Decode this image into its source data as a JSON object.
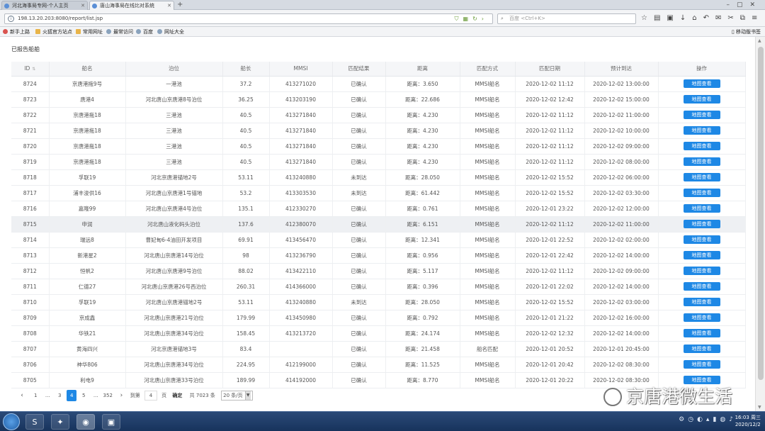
{
  "browser": {
    "tabs": [
      {
        "label": "河北海事局专网-个人主页"
      },
      {
        "label": "唐山海事局在线比对系统"
      }
    ],
    "new_tab": "+",
    "url": "198.13.20.203:8080/report/list.jsp",
    "search_placeholder": "百度 <Ctrl+K>",
    "bookmarks": [
      "新手上路",
      "火狐官方站点",
      "常用网址",
      "最常访问",
      "百度",
      "网址大全"
    ],
    "mobile_bookmarks": "移动版书签"
  },
  "page": {
    "title": "已报告船舶",
    "columns": [
      "ID",
      "船名",
      "泊位",
      "船长",
      "MMSI",
      "匹配结果",
      "距离",
      "匹配方式",
      "匹配日期",
      "预计到达",
      "操作"
    ],
    "action_label": "地图查看",
    "rows": [
      [
        "8724",
        "京唐港拖9号",
        "一港池",
        "37.2",
        "413271020",
        "已确认",
        "距离：3.650",
        "MMSI船名",
        "2020-12-02 11:12",
        "2020-12-02 13:00:00"
      ],
      [
        "8723",
        "唐港4",
        "河北唐山京唐港8号泊位",
        "36.25",
        "413203190",
        "已确认",
        "距离：22.686",
        "MMSI船名",
        "2020-12-02 12:42",
        "2020-12-02 15:00:00"
      ],
      [
        "8722",
        "京唐港拖18",
        "三港池",
        "40.5",
        "413271840",
        "已确认",
        "距离：4.230",
        "MMSI船名",
        "2020-12-02 11:12",
        "2020-12-02 11:00:00"
      ],
      [
        "8721",
        "京唐港拖18",
        "三港池",
        "40.5",
        "413271840",
        "已确认",
        "距离：4.230",
        "MMSI船名",
        "2020-12-02 11:12",
        "2020-12-02 10:00:00"
      ],
      [
        "8720",
        "京唐港拖18",
        "三港池",
        "40.5",
        "413271840",
        "已确认",
        "距离：4.230",
        "MMSI船名",
        "2020-12-02 11:12",
        "2020-12-02 09:00:00"
      ],
      [
        "8719",
        "京唐港拖18",
        "三港池",
        "40.5",
        "413271840",
        "已确认",
        "距离：4.230",
        "MMSI船名",
        "2020-12-02 11:12",
        "2020-12-02 08:00:00"
      ],
      [
        "8718",
        "孚联19",
        "河北京唐港锚地2号",
        "53.11",
        "413240880",
        "未到达",
        "距离：28.050",
        "MMSI船名",
        "2020-12-02 15:52",
        "2020-12-02 06:00:00"
      ],
      [
        "8717",
        "浦丰浚供16",
        "河北唐山京唐港1号锚地",
        "53.2",
        "413303530",
        "未到达",
        "距离：61.442",
        "MMSI船名",
        "2020-12-02 15:52",
        "2020-12-02 03:30:00"
      ],
      [
        "8716",
        "嘉隆99",
        "河北唐山京唐港4号泊位",
        "135.1",
        "412330270",
        "已确认",
        "距离：0.761",
        "MMSI船名",
        "2020-12-01 23:22",
        "2020-12-02 12:00:00"
      ],
      [
        "8715",
        "申润",
        "河北唐山液化码头泊位",
        "137.6",
        "412380070",
        "已确认",
        "距离：6.151",
        "MMSI船名",
        "2020-12-02 11:12",
        "2020-12-02 11:00:00"
      ],
      [
        "8714",
        "瑞远8",
        "曹妃甸6-4油田开发项目",
        "69.91",
        "413456470",
        "已确认",
        "距离：12.341",
        "MMSI船名",
        "2020-12-01 22:52",
        "2020-12-02 02:00:00"
      ],
      [
        "8713",
        "新港星2",
        "河北唐山京唐港14号泊位",
        "98",
        "413236790",
        "已确认",
        "距离：0.956",
        "MMSI船名",
        "2020-12-01 22:42",
        "2020-12-02 14:00:00"
      ],
      [
        "8712",
        "恒帆2",
        "河北唐山京唐港9号泊位",
        "88.02",
        "413422110",
        "已确认",
        "距离：5.117",
        "MMSI船名",
        "2020-12-02 11:12",
        "2020-12-02 09:00:00"
      ],
      [
        "8711",
        "仁德27",
        "河北唐山京唐港26号西泊位",
        "260.31",
        "414366000",
        "已确认",
        "距离：0.396",
        "MMSI船名",
        "2020-12-01 22:02",
        "2020-12-02 14:00:00"
      ],
      [
        "8710",
        "孚联19",
        "河北唐山京唐港锚地2号",
        "53.11",
        "413240880",
        "未到达",
        "距离：28.050",
        "MMSI船名",
        "2020-12-02 15:52",
        "2020-12-02 03:00:00"
      ],
      [
        "8709",
        "京成鑫",
        "河北唐山京唐港21号泊位",
        "179.99",
        "413450980",
        "已确认",
        "距离：0.792",
        "MMSI船名",
        "2020-12-01 21:22",
        "2020-12-02 16:00:00"
      ],
      [
        "8708",
        "华铁21",
        "河北唐山京唐港34号泊位",
        "158.45",
        "413213720",
        "已确认",
        "距离：24.174",
        "MMSI船名",
        "2020-12-02 12:32",
        "2020-12-02 14:00:00"
      ],
      [
        "8707",
        "黄海四兴",
        "河北京唐港锚地3号",
        "83.4",
        "",
        "已确认",
        "距离：21.458",
        "船名匹配",
        "2020-12-01 20:52",
        "2020-12-01 20:45:00"
      ],
      [
        "8706",
        "神华806",
        "河北唐山京唐港34号泊位",
        "224.95",
        "412199000",
        "已确认",
        "距离：11.525",
        "MMSI船名",
        "2020-12-01 20:42",
        "2020-12-02 08:30:00"
      ],
      [
        "8705",
        "利电9",
        "河北唐山京唐港33号泊位",
        "189.99",
        "414192000",
        "已确认",
        "距离：8.770",
        "MMSI船名",
        "2020-12-01 20:22",
        "2020-12-02 08:30:00"
      ]
    ],
    "pager": {
      "pages": [
        "1",
        "...",
        "3",
        "4",
        "5",
        "...",
        "352"
      ],
      "current": "4",
      "goto_label": "到第",
      "goto_value": "4",
      "page_unit": "页",
      "confirm": "确定",
      "total": "共 7023 条",
      "page_size": "20 条/页"
    }
  },
  "watermark": "京唐港微生活",
  "taskbar": {
    "clock_time": "16:03 周三",
    "clock_date": "2020/12/2"
  }
}
